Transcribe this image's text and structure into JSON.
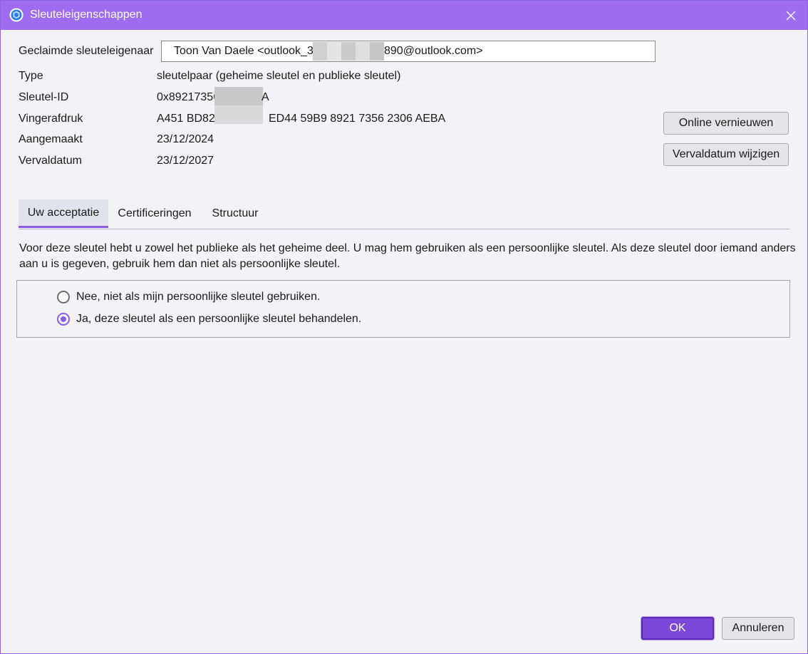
{
  "window": {
    "title": "Sleuteleigenschappen",
    "accent": "#9d6cf0"
  },
  "fields": {
    "owner_label": "Geclaimde sleuteleigenaar",
    "owner_value_start": "Toon Van Daele <outlook_32",
    "owner_value_end": "890@outlook.com>",
    "type_label": "Type",
    "type_value": "sleutelpaar (geheime sleutel en publieke sleutel)",
    "keyid_label": "Sleutel-ID",
    "keyid_value_start": "0x89217356",
    "keyid_value_end": "A",
    "fingerprint_label": "Vingerafdruk",
    "fingerprint_value_start": "A451 BD82",
    "fingerprint_value_end": "ED44 59B9 8921 7356 2306 AEBA",
    "created_label": "Aangemaakt",
    "created_value": "23/12/2024",
    "expiry_label": "Vervaldatum",
    "expiry_value": "23/12/2027"
  },
  "actions": {
    "renew_online": "Online vernieuwen",
    "change_expiry": "Vervaldatum wijzigen"
  },
  "tabs": [
    {
      "label": "Uw acceptatie",
      "active": true
    },
    {
      "label": "Certificeringen",
      "active": false
    },
    {
      "label": "Structuur",
      "active": false
    }
  ],
  "acceptance": {
    "description": "Voor deze sleutel hebt u zowel het publieke als het geheime deel. U mag hem gebruiken als een persoonlijke sleutel. Als deze sleutel door iemand anders aan u is gegeven, gebruik hem dan niet als persoonlijke sleutel.",
    "options": [
      {
        "label": "Nee, niet als mijn persoonlijke sleutel gebruiken.",
        "checked": false
      },
      {
        "label": "Ja, deze sleutel als een persoonlijke sleutel behandelen.",
        "checked": true
      }
    ]
  },
  "footer": {
    "ok": "OK",
    "cancel": "Annuleren"
  }
}
